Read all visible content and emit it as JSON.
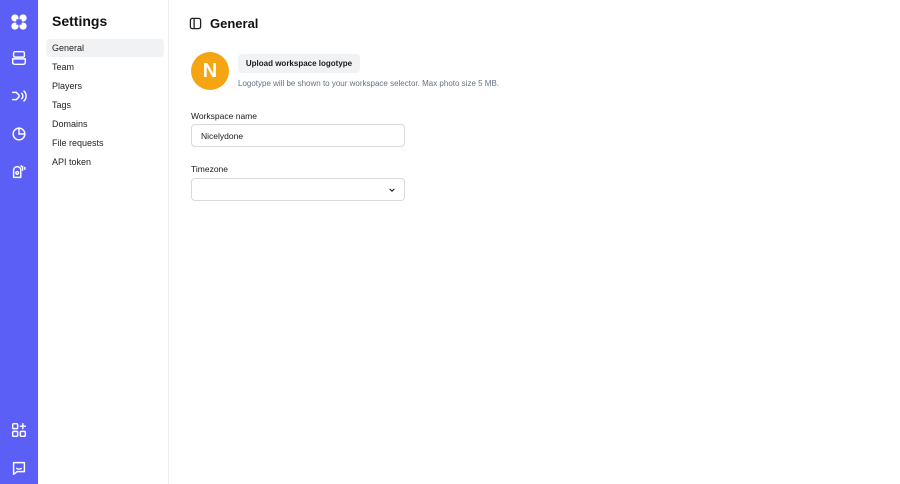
{
  "rail": {
    "icons": [
      "app-logo-icon",
      "layers-icon",
      "broadcast-icon",
      "analytics-icon",
      "campaign-icon",
      "apps-icon",
      "chat-icon"
    ]
  },
  "settings_nav": {
    "title": "Settings",
    "items": [
      {
        "label": "General",
        "active": true
      },
      {
        "label": "Team"
      },
      {
        "label": "Players"
      },
      {
        "label": "Tags"
      },
      {
        "label": "Domains"
      },
      {
        "label": "File requests"
      },
      {
        "label": "API token"
      }
    ]
  },
  "page": {
    "title": "General",
    "toggle_icon": "sidebar-toggle-icon"
  },
  "logo": {
    "initial": "N",
    "color": "#f4a511",
    "upload_label": "Upload workspace logotype",
    "hint": "Logotype will be shown to your workspace selector. Max photo size 5 MB."
  },
  "workspace_name": {
    "label": "Workspace name",
    "value": "Nicelydone"
  },
  "timezone": {
    "label": "Timezone",
    "value": ""
  },
  "colors": {
    "rail": "#5b5ff5",
    "avatar": "#f4a511"
  }
}
